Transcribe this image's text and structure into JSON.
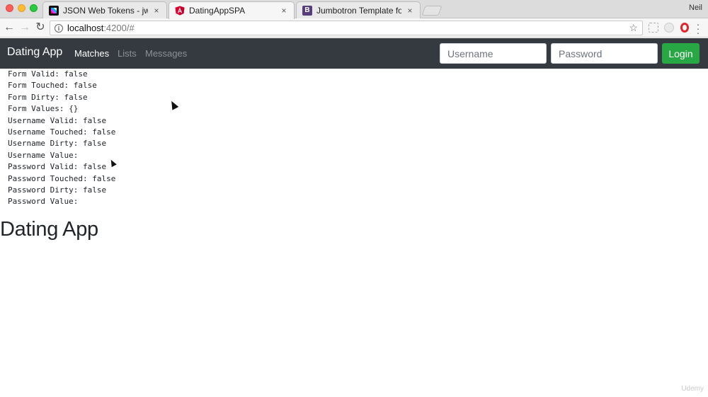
{
  "browser": {
    "tabs": [
      {
        "label": "JSON Web Tokens - jwt.io",
        "icon": "jwt-icon",
        "active": false
      },
      {
        "label": "DatingAppSPA",
        "icon": "angular-icon",
        "active": true
      },
      {
        "label": "Jumbotron Template for Bootstr",
        "icon": "bootstrap-icon",
        "active": false
      }
    ],
    "close_glyph": "×",
    "profile_name": "Neil",
    "url_host": "localhost",
    "url_rest": ":4200/#"
  },
  "navbar": {
    "brand": "Dating App",
    "links": [
      "Matches",
      "Lists",
      "Messages"
    ],
    "username_placeholder": "Username",
    "password_placeholder": "Password",
    "login_label": "Login",
    "background": "#343a40",
    "login_color": "#28a745"
  },
  "debug_lines": [
    "Form Valid: false",
    "Form Touched: false",
    "Form Dirty: false",
    "Form Values: {}",
    "Username Valid: false",
    "Username Touched: false",
    "Username Dirty: false",
    "Username Value:",
    "Password Valid: false",
    "Password Touched: false",
    "Password Dirty: false",
    "Password Value:"
  ],
  "main": {
    "heading": "Dating App"
  },
  "watermark": "Udemy"
}
